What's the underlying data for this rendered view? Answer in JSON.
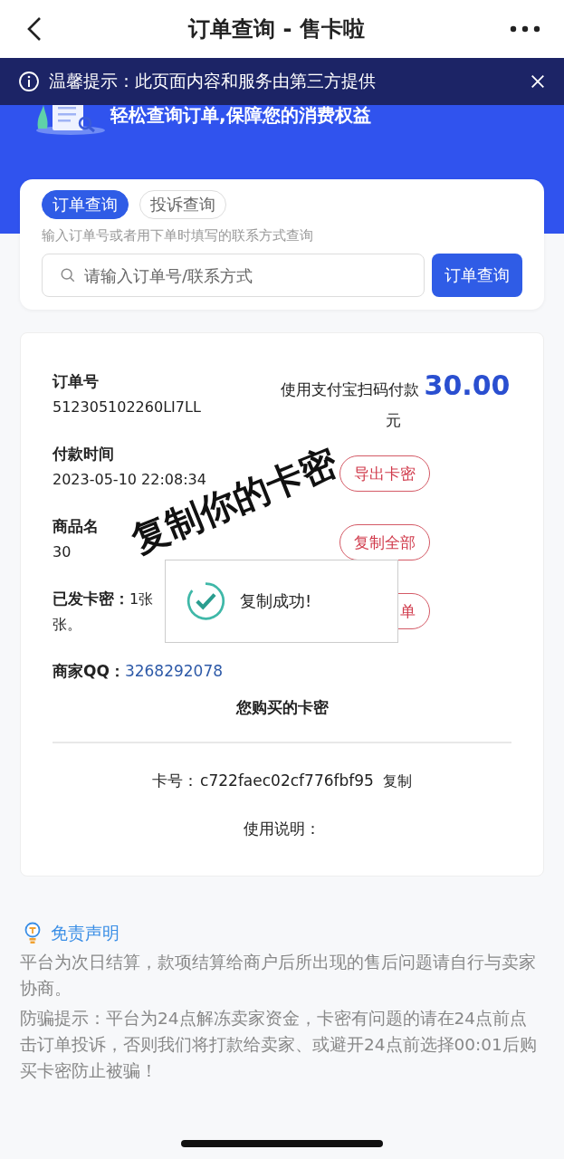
{
  "nav": {
    "title": "订单查询 - 售卡啦"
  },
  "notice": {
    "text": "温馨提示：此页面内容和服务由第三方提供"
  },
  "banner": {
    "slogan": "轻松查询订单,保障您的消费权益"
  },
  "query": {
    "tabs": [
      {
        "label": "订单查询",
        "selected": true
      },
      {
        "label": "投诉查询",
        "selected": false
      }
    ],
    "hint": "输入订单号或者用下单时填写的联系方式查询",
    "search": {
      "placeholder": "请输入订单号/联系方式"
    },
    "button": "订单查询"
  },
  "order": {
    "fields": [
      {
        "label": "订单号",
        "value": "512305102260LI7LL"
      },
      {
        "label": "付款时间",
        "value": "2023-05-10 22:08:34"
      },
      {
        "label": "商品名",
        "value": "30"
      }
    ],
    "issued": {
      "label": "已发卡密：",
      "value": "1张",
      "continuation": "张。"
    },
    "merchant": {
      "label": "商家QQ：",
      "value": "3268292078"
    },
    "payment": {
      "text": "使用支付宝扫码付款",
      "amount": "30.00",
      "unit": "元"
    },
    "actions": [
      "导出卡密",
      "复制全部",
      "单"
    ],
    "cards_title": "您购买的卡密",
    "card": {
      "label": "卡号：",
      "value": "c722faec02cf776fbf95",
      "copy": "复制"
    },
    "usage": "使用说明："
  },
  "toast": {
    "text": "复制成功!"
  },
  "annotation": {
    "text": "复制你的卡密"
  },
  "disclaimer": {
    "title": "免责声明",
    "paragraphs": [
      "平台为次日结算，款项结算给商户后所出现的售后问题请自行与卖家协商。",
      "防骗提示：平台为24点解冻卖家资金，卡密有问题的请在24点前点击订单投诉，否则我们将打款给卖家、或避开24点前选择00:01后购买卡密防止被骗！"
    ]
  }
}
